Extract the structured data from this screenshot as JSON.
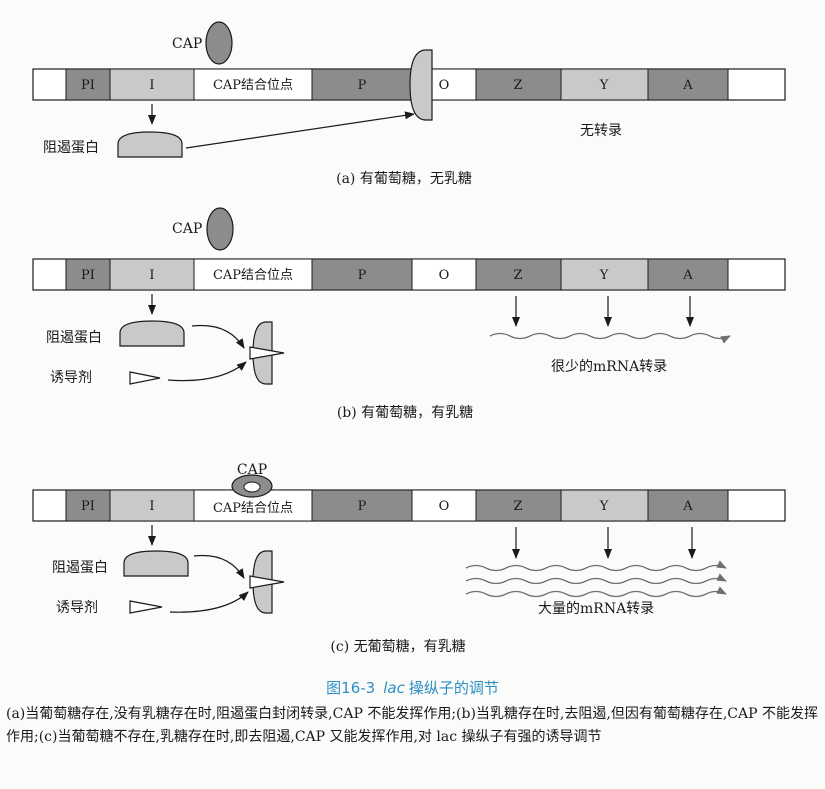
{
  "operon_segments": [
    "PI",
    "I",
    "CAP结合位点",
    "P",
    "O",
    "Z",
    "Y",
    "A"
  ],
  "cap_label": "CAP",
  "repressor_label": "阻遏蛋白",
  "inducer_label": "诱导剂",
  "panels": [
    {
      "caption": "(a) 有葡萄糖，无乳糖",
      "result": "无转录"
    },
    {
      "caption": "(b) 有葡萄糖，有乳糖",
      "result": "很少的mRNA转录"
    },
    {
      "caption": "(c) 无葡萄糖，有乳糖",
      "result": "大量的mRNA转录"
    }
  ],
  "figure": {
    "number": "图16-3",
    "gene": "lac",
    "title": "操纵子的调节",
    "caption": "(a)当葡萄糖存在,没有乳糖存在时,阻遏蛋白封闭转录,CAP 不能发挥作用;(b)当乳糖存在时,去阻遏,但因有葡萄糖存在,CAP 不能发挥作用;(c)当葡萄糖不存在,乳糖存在时,即去阻遏,CAP 又能发挥作用,对 lac 操纵子有强的诱导调节"
  },
  "colors": {
    "dark_gray": "#8c8c8c",
    "light_gray": "#c9c9c9",
    "medium_gray": "#b0b0b0",
    "caption_blue": "#2d8fc4"
  }
}
